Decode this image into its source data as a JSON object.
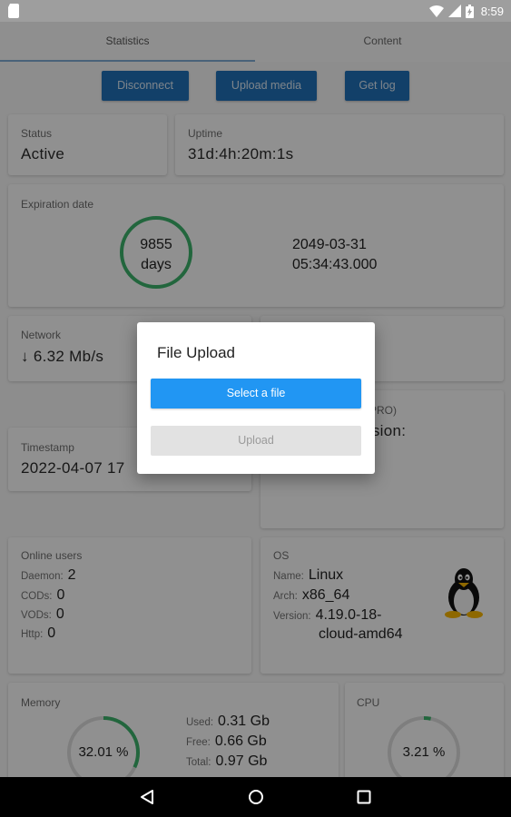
{
  "status_bar": {
    "time": "8:59"
  },
  "tabs": [
    {
      "label": "Statistics"
    },
    {
      "label": "Content"
    }
  ],
  "toolbar": {
    "disconnect": "Disconnect",
    "upload_media": "Upload media",
    "get_log": "Get log"
  },
  "status": {
    "label": "Status",
    "value": "Active"
  },
  "uptime": {
    "label": "Uptime",
    "value": "31d:4h:20m:1s"
  },
  "expiration": {
    "label": "Expiration date",
    "days_number": "9855",
    "days_unit": "days",
    "date": "2049-03-31",
    "time": "05:34:43.000"
  },
  "network": {
    "label": "Network",
    "arrow": "↓",
    "value": "6.32 Mb/s"
  },
  "license": {
    "partial_label": "d PRO)",
    "partial_value": "vision:"
  },
  "timestamp": {
    "label": "Timestamp",
    "value": "2022-04-07 17"
  },
  "online_users": {
    "label": "Online users",
    "rows": [
      {
        "key": "Daemon:",
        "value": "2"
      },
      {
        "key": "CODs:",
        "value": "0"
      },
      {
        "key": "VODs:",
        "value": "0"
      },
      {
        "key": "Http:",
        "value": "0"
      }
    ]
  },
  "os": {
    "label": "OS",
    "name_key": "Name:",
    "name_value": "Linux",
    "arch_key": "Arch:",
    "arch_value": "x86_64",
    "version_key": "Version:",
    "version_line1": "4.19.0-18-",
    "version_line2": "cloud-amd64"
  },
  "memory": {
    "label": "Memory",
    "percent_text": "32.01 %",
    "percent": 32.01,
    "used_key": "Used:",
    "used_value": "0.31 Gb",
    "free_key": "Free:",
    "free_value": "0.66 Gb",
    "total_key": "Total:",
    "total_value": "0.97 Gb"
  },
  "cpu": {
    "label": "CPU",
    "percent_text": "3.21 %",
    "percent": 3.21
  },
  "dialog": {
    "title": "File Upload",
    "select_label": "Select a file",
    "upload_label": "Upload"
  },
  "colors": {
    "accent": "#2196f3",
    "button": "#1f6fb5",
    "ring": "#3bb06a"
  }
}
